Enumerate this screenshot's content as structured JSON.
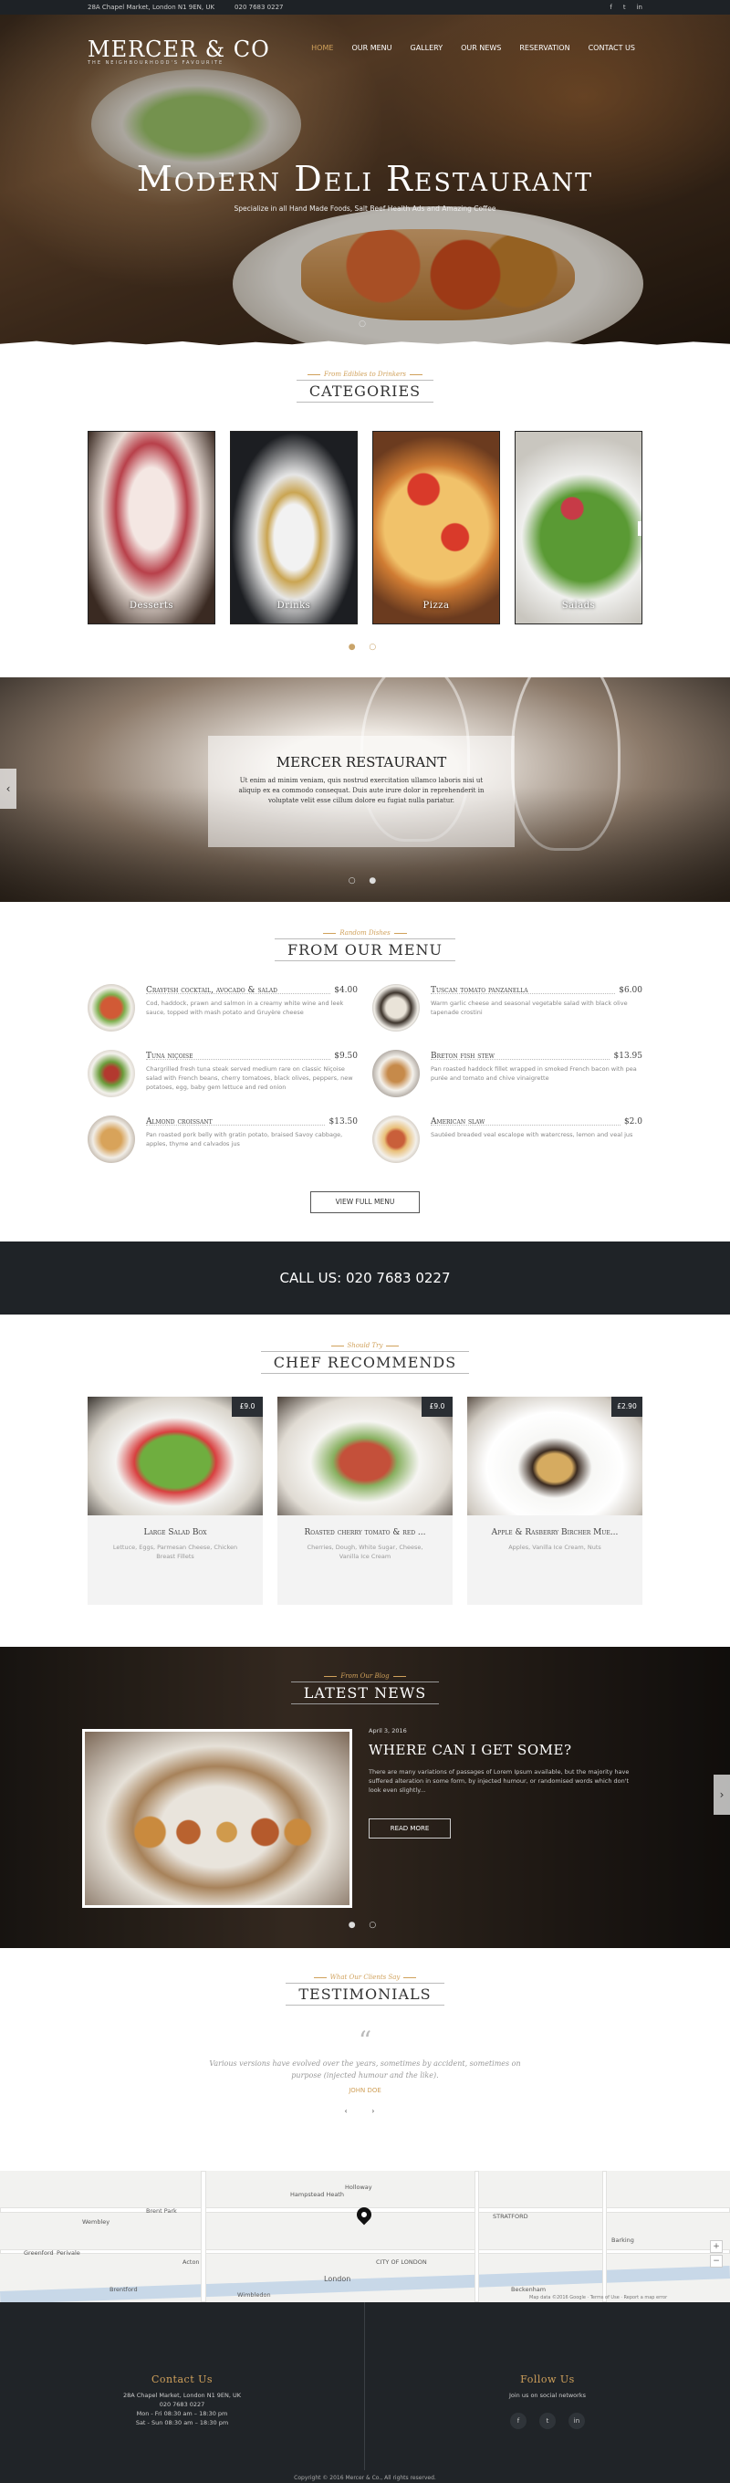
{
  "topbar": {
    "address": "28A Chapel Market, London N1 9EN, UK",
    "phone": "020 7683 0227",
    "social": [
      "f",
      "t",
      "in"
    ]
  },
  "logo": {
    "name": "MERCER & CO",
    "tagline": "THE NEIGHBOURHOOD'S FAVOURITE"
  },
  "nav": [
    {
      "label": "HOME",
      "active": true
    },
    {
      "label": "OUR MENU"
    },
    {
      "label": "GALLERY"
    },
    {
      "label": "OUR NEWS"
    },
    {
      "label": "RESERVATION"
    },
    {
      "label": "CONTACT US"
    }
  ],
  "hero": {
    "title": "Modern Deli Restaurant",
    "subtitle": "Specialize in all Hand Made Foods, Salt Beef Health Ads and Amazing Coffee",
    "dots": "○"
  },
  "categories": {
    "kicker": "From Edibles to Drinkers",
    "title": "CATEGORIES",
    "items": [
      "Desserts",
      "Drinks",
      "Pizza",
      "Salads"
    ],
    "dots": "● ○"
  },
  "about": {
    "title": "MERCER RESTAURANT",
    "text": "Ut enim ad minim veniam, quis nostrud exercitation ullamco laboris nisi ut aliquip ex ea commodo consequat. Duis aute irure dolor in reprehenderit in voluptate velit esse cillum dolore eu fugiat nulla pariatur.",
    "dots": "○ ●"
  },
  "menu": {
    "kicker": "Random Dishes",
    "title": "FROM OUR MENU",
    "items": [
      {
        "name": "Crayfish cocktail, avocado & salad",
        "price": "$4.00",
        "desc": "Cod, haddock, prawn and salmon in a creamy white wine and leek sauce, topped with mash potato and Gruyère cheese"
      },
      {
        "name": "Tuscan tomato panzanella",
        "price": "$6.00",
        "desc": "Warm garlic cheese and seasonal vegetable salad with black olive tapenade crostini"
      },
      {
        "name": "Tuna niçoise",
        "price": "$9.50",
        "desc": "Chargrilled fresh tuna steak served medium rare on classic Niçoise salad with French beans, cherry tomatoes, black olives, peppers, new potatoes, egg, baby gem lettuce and red onion"
      },
      {
        "name": "Breton fish stew",
        "price": "$13.95",
        "desc": "Pan roasted haddock fillet wrapped in smoked French bacon with pea purée and tomato and chive vinaigrette"
      },
      {
        "name": "Almond croissant",
        "price": "$13.50",
        "desc": "Pan roasted pork belly with gratin potato, braised Savoy cabbage, apples, thyme and calvados jus"
      },
      {
        "name": "American slaw",
        "price": "$2.0",
        "desc": "Sautéed breaded veal escalope with watercress, lemon and veal jus"
      }
    ],
    "button": "VIEW FULL MENU"
  },
  "callbar": {
    "text": "CALL US: 020 7683 0227"
  },
  "chef": {
    "kicker": "Should Try",
    "title": "CHEF RECOMMENDS",
    "items": [
      {
        "name": "Large Salad Box",
        "price": "£9.0",
        "desc": "Lettuce, Eggs, Parmesan Cheese, Chicken Breast Fillets"
      },
      {
        "name": "Roasted cherry tomato & red ...",
        "price": "£9.0",
        "desc": "Cherries, Dough, White Sugar, Cheese, Vanilla Ice Cream"
      },
      {
        "name": "Apple & Rasberry Bircher Mue...",
        "price": "£2.90",
        "desc": "Apples, Vanilla Ice Cream, Nuts"
      }
    ]
  },
  "news": {
    "kicker": "From Our Blog",
    "title": "LATEST NEWS",
    "date": "April 3, 2016",
    "headline": "WHERE CAN I GET SOME?",
    "text": "There are many variations of passages of Lorem Ipsum available, but the majority have suffered alteration in some form, by injected humour, or randomised words which don't look even slightly...",
    "button": "READ MORE",
    "dots": "● ○"
  },
  "testimonials": {
    "kicker": "What Our Clients Say",
    "title": "TESTIMONIALS",
    "quote_mark": "“",
    "text": "Various versions have evolved over the years, sometimes by accident, sometimes on purpose (injected humour and the like).",
    "author": "JOHN DOE",
    "nav": "‹ ›"
  },
  "map": {
    "labels": [
      "Wembley",
      "Brent Park",
      "Hampstead Heath",
      "Holloway",
      "STRATFORD",
      "Greenford",
      "Perivale",
      "Acton",
      "CITY OF LONDON",
      "London",
      "Barking",
      "Brentford",
      "Wimbledon",
      "Beckenham"
    ],
    "controls": [
      "+",
      "−"
    ],
    "attribution": "Map data ©2016 Google · Terms of Use · Report a map error"
  },
  "footer": {
    "contact_title": "Contact Us",
    "contact_lines": [
      "28A Chapel Market, London N1 9EN, UK",
      "020 7683 0227",
      "Mon - Fri 08:30 am – 18:30 pm",
      "Sat - Sun 08:30 am – 18:30 pm"
    ],
    "follow_title": "Follow Us",
    "follow_text": "Join us on social networks",
    "social": [
      "f",
      "t",
      "in"
    ],
    "copyright": "Copyright © 2016 Mercer & Co., All rights reserved."
  }
}
